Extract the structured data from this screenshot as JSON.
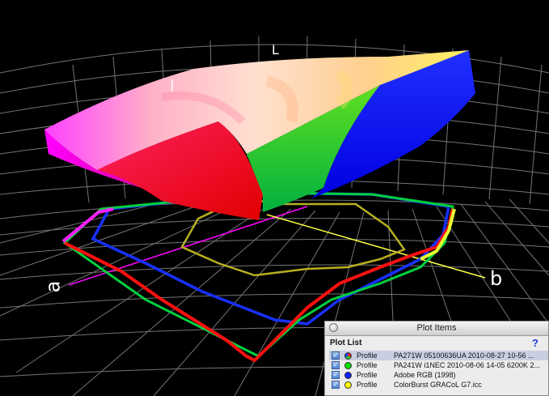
{
  "axes": {
    "l_label": "L",
    "a_label": "a",
    "b_label": "b"
  },
  "colors": {
    "background": "#000000",
    "grid": "#a0a0a0",
    "a_axis": "#ff00ff",
    "b_axis": "#ffff40"
  },
  "panel": {
    "title": "Plot Items",
    "list_label": "Plot List",
    "help_label": "?",
    "rows": [
      {
        "type": "Profile",
        "name": "PA271W 05100636UA 2010-08-27 10-56 ...",
        "swatch": "multi",
        "checked": true,
        "selected": true
      },
      {
        "type": "Profile",
        "name": "PA241W i1NEC 2010-08-06 14-05 6200K 2...",
        "swatch": "#00e000",
        "checked": true,
        "selected": false
      },
      {
        "type": "Profile",
        "name": "Adobe RGB (1998)",
        "swatch": "#1020ff",
        "checked": true,
        "selected": false
      },
      {
        "type": "Profile",
        "name": "ColorBurst GRACoL G7.icc",
        "swatch": "#ffff00",
        "checked": true,
        "selected": false
      }
    ]
  }
}
